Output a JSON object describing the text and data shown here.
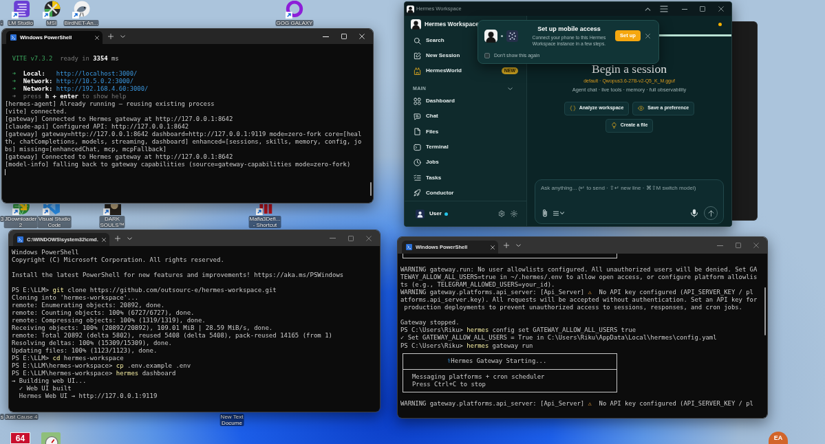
{
  "desktop": {
    "icons": [
      {
        "kind": "none",
        "label": [
          "-"
        ]
      },
      {
        "kind": "lines",
        "label": [
          "LM Studio"
        ],
        "shortcut": true
      },
      {
        "kind": "disc",
        "label": [
          "MSI"
        ],
        "shortcut": true
      },
      {
        "kind": "bird",
        "label": [
          "BirdNET-An..."
        ],
        "shortcut": true
      },
      {
        "kind": "ring",
        "label": [
          "GOG GALAXY"
        ],
        "shortcut": true
      },
      {
        "kind": "none",
        "label": [
          "3"
        ]
      },
      {
        "kind": "globe",
        "label": [
          "JDownloader",
          "2"
        ],
        "shortcut": true
      },
      {
        "kind": "ribbon",
        "label": [
          "Visual Studio",
          "Code"
        ],
        "shortcut": true
      },
      {
        "kind": "photo",
        "label": [
          "DARK",
          "SOULS™"
        ],
        "shortcut": true
      },
      {
        "kind": "bars",
        "label": [
          "Mafia3Defi...",
          "- Shortcut"
        ],
        "shortcut": true
      },
      {
        "kind": "none",
        "label": [
          "s"
        ]
      },
      {
        "kind": "none",
        "label": [
          "Just Cause 4"
        ]
      },
      {
        "kind": "none",
        "label": [
          "New Text",
          "Docume"
        ]
      },
      {
        "kind": "tile",
        "glyph": "64"
      },
      {
        "kind": "gauge"
      },
      {
        "kind": "badge",
        "glyph": "EA"
      }
    ]
  },
  "terminals": [
    {
      "tab": "Windows PowerShell",
      "focused": true,
      "blocks": [
        {
          "kind": "lines",
          "lines": [
            [
              {
                "text": "  VITE v7.3.2",
                "kind": "green"
              },
              {
                "text": "  ready in ",
                "kind": "dim"
              },
              {
                "text": "3354",
                "kind": "bold"
              },
              {
                "text": " ms",
                "kind": "plain"
              }
            ]
          ]
        },
        {
          "kind": "lines",
          "lines": [
            [
              {
                "text": "  ➜  ",
                "kind": "green"
              },
              {
                "text": "Local:   ",
                "kind": "bold"
              },
              {
                "text": "http://localhost:3000/",
                "kind": "cyan"
              }
            ],
            [
              {
                "text": "  ➜  ",
                "kind": "green"
              },
              {
                "text": "Network: ",
                "kind": "bold"
              },
              {
                "text": "http://10.5.0.2:3000/",
                "kind": "cyan"
              }
            ],
            [
              {
                "text": "  ➜  ",
                "kind": "green"
              },
              {
                "text": "Network: ",
                "kind": "bold"
              },
              {
                "text": "http://192.168.4.60:3000/",
                "kind": "cyan"
              }
            ],
            [
              {
                "text": "  ➜  press ",
                "kind": "dim"
              },
              {
                "text": "h + enter",
                "kind": "bold"
              },
              {
                "text": " to show help",
                "kind": "dim"
              }
            ],
            "[hermes-agent] Already running — reusing existing process",
            "[vite] connected.",
            "[gateway] Connected to Hermes gateway at http://127.0.0.1:8642",
            "[claude-api] Configured API: http://127.0.0.1:8642",
            "[gateway] gateway=http://127.0.0.1:8642 dashboard=http://127.0.0.1:9119 mode=zero-fork core=[heal",
            "th, chatCompletions, models, streaming, dashboard] enhanced=[sessions, skills, memory, config, jo",
            "bs] missing=[enhancedChat, mcp, mcpFallback]",
            "[gateway] Connected to Hermes gateway at http://127.0.0.1:8642",
            "[model-info] falling back to gateway capabilities (source=gateway-capabilities mode=zero-fork)"
          ]
        }
      ]
    },
    {
      "tab": "C:\\WINDOWS\\system32\\cmd.",
      "focused": false,
      "blocks": [
        {
          "kind": "lines",
          "lines": [
            "Windows PowerShell",
            "Copyright (C) Microsoft Corporation. All rights reserved."
          ]
        },
        {
          "kind": "lines",
          "lines": [
            "Install the latest PowerShell for new features and improvements! https://aka.ms/PSWindows"
          ]
        },
        {
          "kind": "lines",
          "lines": [
            [
              {
                "text": "PS E:\\LLM> ",
                "kind": "plain"
              },
              {
                "text": "git",
                "kind": "yellow"
              },
              {
                "text": " clone https://github.com/outsourc-e/hermes-workspace.git",
                "kind": "plain"
              }
            ],
            "Cloning into 'hermes-workspace'...",
            "remote: Enumerating objects: 20892, done.",
            "remote: Counting objects: 100% (6727/6727), done.",
            "remote: Compressing objects: 100% (1319/1319), done.",
            "Receiving objects: 100% (20892/20892), 109.01 MiB | 28.59 MiB/s, done.",
            "remote: Total 20892 (delta 5802), reused 5408 (delta 5408), pack-reused 14165 (from 1)",
            "Resolving deltas: 100% (15309/15309), done.",
            "Updating files: 100% (1123/1123), done.",
            [
              {
                "text": "PS E:\\LLM> ",
                "kind": "plain"
              },
              {
                "text": "cd",
                "kind": "yellow"
              },
              {
                "text": " hermes-workspace",
                "kind": "plain"
              }
            ],
            [
              {
                "text": "PS E:\\LLM\\hermes-workspace> ",
                "kind": "plain"
              },
              {
                "text": "cp",
                "kind": "yellow"
              },
              {
                "text": " .env.example .env",
                "kind": "plain"
              }
            ],
            [
              {
                "text": "PS E:\\LLM\\hermes-workspace> ",
                "kind": "plain"
              },
              {
                "text": "hermes",
                "kind": "yellow"
              },
              {
                "text": " dashboard",
                "kind": "plain"
              }
            ],
            "→ Building web UI...",
            "  ✓ Web UI built",
            "  Hermes Web UI → http://127.0.0.1:9119"
          ]
        }
      ]
    },
    {
      "tab": "Windows PowerShell",
      "focused": false,
      "blocks": [
        {
          "kind": "banner_end"
        },
        {
          "kind": "lines",
          "lines": [
            "WARNING gateway.run: No user allowlists configured. All unauthorized users will be denied. Set GA",
            "TEWAY_ALLOW_ALL_USERS=true in ~/.hermes/.env to allow open access, or configure platform allowlis",
            "ts (e.g., TELEGRAM_ALLOWED_USERS=your_id).",
            [
              {
                "text": "WARNING gateway.platforms.api_server: [Api_Server] ",
                "kind": "plain"
              },
              {
                "text": "⚠",
                "kind": "warn"
              },
              {
                "text": "  No API key configured (API_SERVER_KEY / pl",
                "kind": "plain"
              }
            ],
            "atforms.api_server.key). All requests will be accepted without authentication. Set an API key for",
            " production deployments to prevent unauthorized access to sessions, responses, and cron jobs."
          ]
        },
        {
          "kind": "lines",
          "lines": [
            "Gateway stopped.",
            [
              {
                "text": "PS C:\\Users\\Riku> ",
                "kind": "plain"
              },
              {
                "text": "hermes",
                "kind": "yellow"
              },
              {
                "text": " config set GATEWAY_ALLOW_ALL_USERS true",
                "kind": "plain"
              }
            ],
            "✓ Set GATEWAY_ALLOW_ALL_USERS = True in C:\\Users\\Riku\\AppData\\Local\\hermes\\config.yaml",
            [
              {
                "text": "PS C:\\Users\\Riku> ",
                "kind": "plain"
              },
              {
                "text": "hermes",
                "kind": "yellow"
              },
              {
                "text": " gateway run",
                "kind": "plain"
              }
            ]
          ]
        },
        {
          "kind": "banner",
          "icon": "⚕",
          "title": "Hermes Gateway Starting...",
          "lines": [
            "Messaging platforms + cron scheduler",
            "Press Ctrl+C to stop"
          ]
        },
        {
          "kind": "lines",
          "lines": [
            [
              {
                "text": "WARNING gateway.platforms.api_server: [Api_Server] ",
                "kind": "plain"
              },
              {
                "text": "⚠",
                "kind": "warn"
              },
              {
                "text": "  No API key configured (API_SERVER_KEY / pl",
                "kind": "plain"
              }
            ]
          ]
        }
      ]
    }
  ],
  "hermes": {
    "title": "Hermes Workspace",
    "sidebar": {
      "brand": "Hermes Workspace",
      "top_items": [
        {
          "label": "Search"
        },
        {
          "label": "New Session"
        },
        {
          "label": "HermesWorld",
          "badge": "NEW"
        }
      ],
      "section": {
        "label": "MAIN",
        "expanded": true,
        "items": [
          {
            "label": "Dashboard"
          },
          {
            "label": "Chat"
          },
          {
            "label": "Files"
          },
          {
            "label": "Terminal"
          },
          {
            "label": "Jobs"
          },
          {
            "label": "Tasks"
          },
          {
            "label": "Conductor"
          }
        ]
      },
      "user": {
        "name": "User",
        "online": true
      }
    },
    "main": {
      "heading": "Begin a session",
      "model": "default · Qwopus3.6-27B-v2-Q5_K_M.gguf",
      "tagline": "Agent chat · live tools · memory · full observability",
      "suggestions": [
        {
          "label": "Analyze workspace"
        },
        {
          "label": "Save a preference"
        },
        {
          "label": "Create a file"
        }
      ],
      "composer": {
        "placeholder": "Ask anything... (↵ to send · ⇧↵ new line · ⌘⇧M switch model)"
      }
    },
    "popup": {
      "title": "Set up mobile access",
      "body": "Connect your phone to this Hermes Workspace instance in a few steps.",
      "action": "Set up",
      "dont_show": {
        "label": "Don't show this again",
        "checked": false
      }
    }
  }
}
